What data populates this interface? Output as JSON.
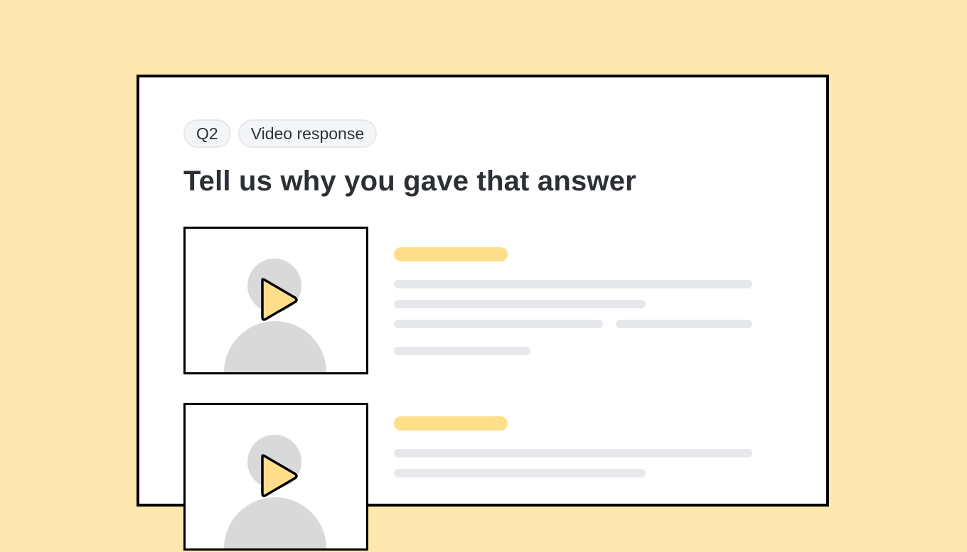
{
  "question": {
    "number_tag": "Q2",
    "type_tag": "Video response",
    "title": "Tell us why you gave that answer"
  },
  "icons": {
    "play": "play-icon",
    "person": "person-placeholder-icon"
  },
  "colors": {
    "background": "#FEE8B0",
    "highlight_bar": "#FFDE8A",
    "placeholder_bar": "#E6E8EB",
    "avatar_gray": "#D9D9D9",
    "play_fill": "#FFDE8A"
  },
  "responses": [
    {
      "id": "response-1",
      "media": "video"
    },
    {
      "id": "response-2",
      "media": "video"
    }
  ]
}
